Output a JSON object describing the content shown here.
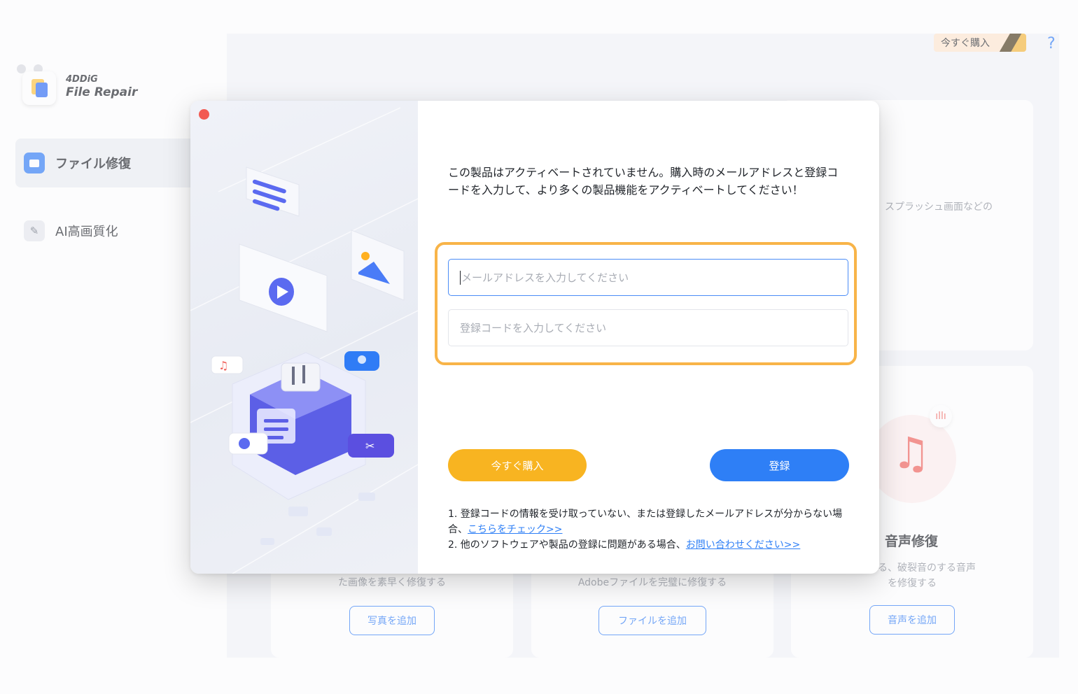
{
  "app": {
    "logo_line1": "4DDiG",
    "logo_line2": "File Repair",
    "buy_badge": "今すぐ購入"
  },
  "sidebar": {
    "items": [
      {
        "label": "ファイル修復",
        "icon": "folder-icon",
        "active": true
      },
      {
        "label": "AI高画質化",
        "icon": "ai-magic-wand-icon",
        "active": false
      }
    ]
  },
  "cards": {
    "top_right_desc": "スプラッシュ画面などの",
    "audio_title": "音声修復",
    "audio_desc_1": "途切れる、破裂音のする音声",
    "audio_desc_2": "を修復する",
    "photo_desc": "た画像を素早く修復する",
    "file_desc": "Adobeファイルを完璧に修復する",
    "photo_btn": "写真を追加",
    "file_btn": "ファイルを追加",
    "audio_btn": "音声を追加"
  },
  "dialog": {
    "message": "この製品はアクティベートされていません。購入時のメールアドレスと登録コードを入力して、より多くの製品機能をアクティベートしてください！",
    "email_placeholder": "メールアドレスを入力してください",
    "code_placeholder": "登録コードを入力してください",
    "buy_button": "今すぐ購入",
    "register_button": "登録",
    "note1_prefix": "1. 登録コードの情報を受け取っていない、または登録したメールアドレスが分からない場合、",
    "note1_link": "こちらをチェック>>",
    "note2_prefix": "2. 他のソフトウェアや製品の登録に問題がある場合、",
    "note2_link": "お問い合わせください>>"
  },
  "colors": {
    "accent_blue": "#2e7ff6",
    "accent_orange": "#f8b421",
    "highlight_orange": "#f8b448",
    "close_red": "#f25a52"
  }
}
